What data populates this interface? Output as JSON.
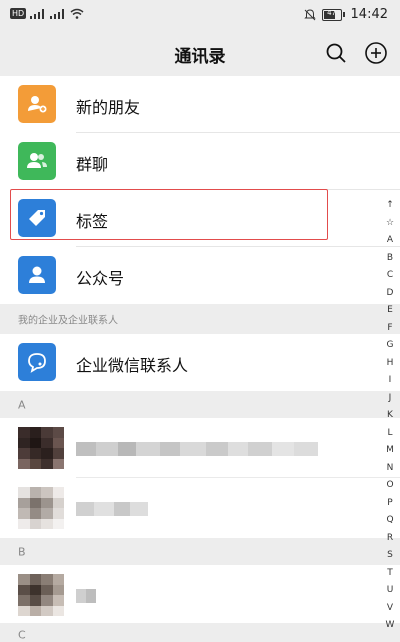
{
  "status": {
    "carrier_badge": "HD",
    "battery": "47",
    "time": "14:42"
  },
  "header": {
    "title": "通讯录"
  },
  "menu": [
    {
      "label": "新的朋友",
      "icon": "add-friend-icon",
      "color": "#f39c38"
    },
    {
      "label": "群聊",
      "icon": "group-icon",
      "color": "#3fb85a"
    },
    {
      "label": "标签",
      "icon": "tag-icon",
      "color": "#2d7fd9"
    },
    {
      "label": "公众号",
      "icon": "official-account-icon",
      "color": "#2d7fd9"
    }
  ],
  "sections": {
    "enterprise_header": "我的企业及企业联系人",
    "enterprise_item": {
      "label": "企业微信联系人",
      "icon": "enterprise-contact-icon",
      "color": "#2d7fd9"
    },
    "a": "A",
    "b": "B",
    "c": "C"
  },
  "index": [
    "↑",
    "☆",
    "A",
    "B",
    "C",
    "D",
    "E",
    "F",
    "G",
    "H",
    "I",
    "J",
    "K",
    "L",
    "M",
    "N",
    "O",
    "P",
    "Q",
    "R",
    "S",
    "T",
    "U",
    "V",
    "W"
  ]
}
